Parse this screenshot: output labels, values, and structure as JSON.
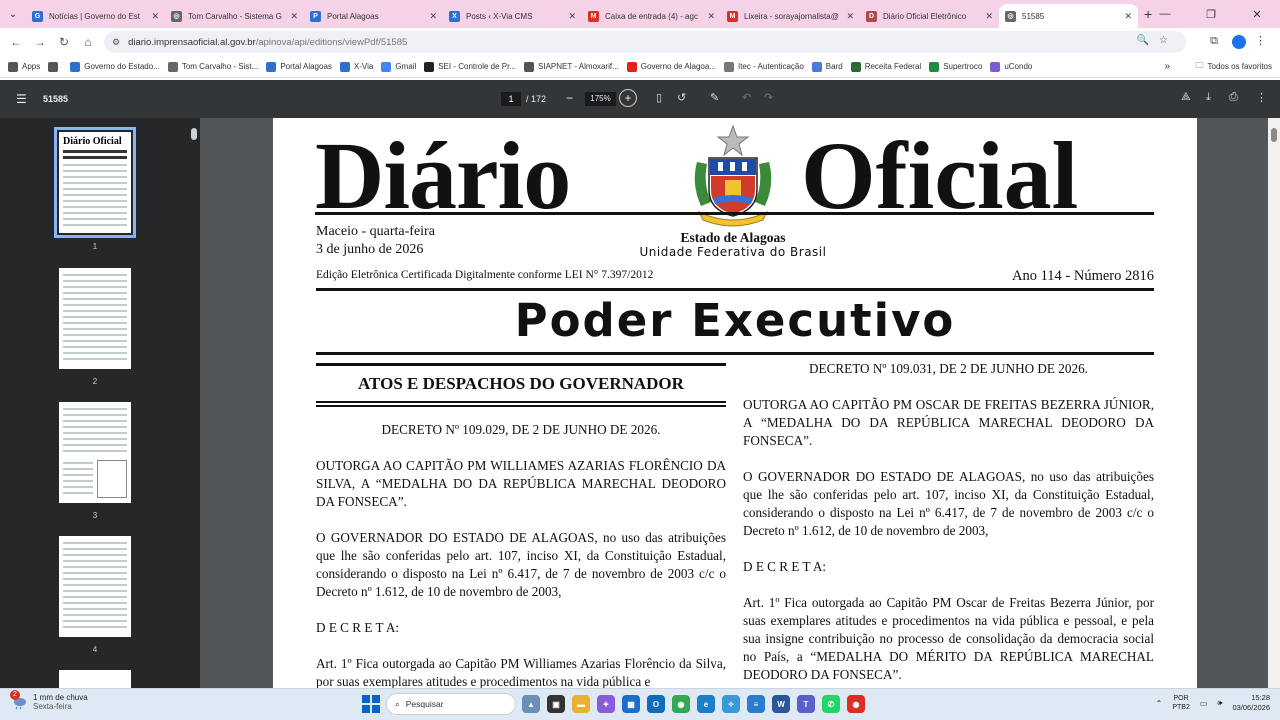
{
  "tabs": [
    {
      "title": "Notícias | Governo do Est",
      "icon": "gov-icon",
      "color": "#2e6fd0",
      "letter": "G"
    },
    {
      "title": "Tom Carvalho - Sistema G",
      "icon": "globe-icon",
      "color": "#666666",
      "letter": "◎"
    },
    {
      "title": "Portal Alagoas",
      "icon": "portal-icon",
      "color": "#2e6fd0",
      "letter": "P"
    },
    {
      "title": "Posts ‹ X-Via CMS",
      "icon": "cms-icon",
      "color": "#2e6fd0",
      "letter": "X"
    },
    {
      "title": "Caixa de entrada (4) - agc",
      "icon": "gmail-icon",
      "color": "#d93025",
      "letter": "M"
    },
    {
      "title": "Lixeira - sorayajornalista@",
      "icon": "gmail-icon",
      "color": "#d93025",
      "letter": "M"
    },
    {
      "title": "Diário Oficial Eletrônico",
      "icon": "diario-icon",
      "color": "#b04848",
      "letter": "D"
    },
    {
      "title": "51585",
      "icon": "globe-icon",
      "color": "#666666",
      "letter": "◎"
    }
  ],
  "address": {
    "host": "diario.imprensaoficial.al.gov.br",
    "path": "/apinova/api/editions/viewPdf/51585"
  },
  "bookmarks": [
    {
      "label": "Apps",
      "color": "#555555"
    },
    {
      "label": "",
      "color": "#555555"
    },
    {
      "label": "Governo do Estado...",
      "color": "#2e6fd0"
    },
    {
      "label": "Tom Carvalho - Sist...",
      "color": "#666666"
    },
    {
      "label": "Portal Alagoas",
      "color": "#2e6fd0"
    },
    {
      "label": "X-Via",
      "color": "#2e6fd0"
    },
    {
      "label": "Gmail",
      "color": "#4285f4"
    },
    {
      "label": "SEI - Controle de Pr...",
      "color": "#222222"
    },
    {
      "label": "SIAPNET - Almoxarif...",
      "color": "#555555"
    },
    {
      "label": "Governo de Alagoa...",
      "color": "#e62117"
    },
    {
      "label": "Itec - Autenticação",
      "color": "#777777"
    },
    {
      "label": "Bard",
      "color": "#4a7bd8"
    },
    {
      "label": "Receita Federal",
      "color": "#2a6b3a"
    },
    {
      "label": "Supertroco",
      "color": "#1e8e3e"
    },
    {
      "label": "uCondo",
      "color": "#7b5cd6"
    }
  ],
  "bookmarks_all": "Todos os favoritos",
  "pdf": {
    "doc_title": "51585",
    "page": "1",
    "page_total": "/ 172",
    "zoom": "175%"
  },
  "thumbs": [
    "1",
    "2",
    "3",
    "4"
  ],
  "doc": {
    "mast_left": "Diário",
    "mast_right": "Oficial",
    "city": "Maceio - quarta-feira",
    "date": "3 de junho de 2026",
    "estado": "Estado de Alagoas",
    "uniao": "Unidade Federativa do Brasil",
    "edicao": "Edição Eletrônica Certificada Digitalmente conforme LEI N° 7.397/2012",
    "ano": "Ano 114 - Número 2816",
    "poder": "Poder Executivo",
    "atos": "ATOS E DESPACHOS DO GOVERNADOR",
    "left": {
      "decreto": "DECRETO Nº 109.029, DE 2 DE JUNHO DE 2026.",
      "outorga": "OUTORGA AO CAPITÃO PM WILLIAMES AZARIAS FLORÊNCIO DA SILVA, A “MEDALHA DO    DA REPÚBLICA MARECHAL DEODORO DA FONSECA”.",
      "governador": "O GOVERNADOR DO ESTADO DE ALAGOAS, no uso das atribuições que lhe são conferidas pelo art. 107, inciso XI, da Constituição Estadual, considerando o disposto na Lei nº 6.417, de 7 de novembro de 2003 c/c o Decreto nº 1.612, de 10 de novembro de 2003,",
      "decreta": "D E C R E T A:",
      "art1": "Art. 1º Fica outorgada ao Capitão PM Williames Azarias Florêncio da Silva, por suas exemplares atitudes e procedimentos na vida pública e"
    },
    "right": {
      "decreto": "DECRETO Nº 109.031, DE 2 DE JUNHO DE 2026.",
      "outorga": "OUTORGA AO CAPITÃO PM OSCAR DE FREITAS BEZERRA JÚNIOR, A “MEDALHA DO    DA REPÚBLICA MARECHAL DEODORO DA FONSECA”.",
      "governador": "O GOVERNADOR DO ESTADO DE ALAGOAS, no uso das atribuições que lhe são conferidas pelo art. 107, inciso XI, da Constituição Estadual, considerando o disposto na Lei nº 6.417, de 7 de novembro de 2003 c/c o Decreto nº 1.612, de 10 de novembro de 2003,",
      "decreta": "D E C R E T A:",
      "art1": "Art. 1º Fica outorgada ao Capitão PM Oscar de Freitas Bezerra Júnior, por suas exemplares atitudes e procedimentos na vida pública e pessoal, e pela sua insigne contribuição no processo de consolidação da democracia social no País, a “MEDALHA DO MÉRITO DA REPÚBLICA MARECHAL DEODORO DA FONSECA”."
    }
  },
  "taskbar": {
    "badge": "2",
    "weather": "1 mm de chuva",
    "weekday": "Sexta-feira",
    "search": "Pesquisar",
    "lang1": "POR",
    "lang2": "PTB2",
    "time": "15:28",
    "date": "03/06/2026",
    "apps": [
      {
        "name": "landscape-icon",
        "color": "#6b8fb5",
        "g": "▲"
      },
      {
        "name": "task-view-icon",
        "color": "#333333",
        "g": "▣"
      },
      {
        "name": "file-explorer-icon",
        "color": "#e8b230",
        "g": "▬"
      },
      {
        "name": "copilot-icon",
        "color": "#8a5cd8",
        "g": "✦"
      },
      {
        "name": "store-icon",
        "color": "#1c6ec9",
        "g": "▦"
      },
      {
        "name": "outlook-icon",
        "color": "#0f6cbd",
        "g": "O"
      },
      {
        "name": "chrome-icon",
        "color": "#34a853",
        "g": "◉"
      },
      {
        "name": "edge-icon",
        "color": "#1a7fc8",
        "g": "e"
      },
      {
        "name": "copilot-app-icon",
        "color": "#3a9ad9",
        "g": "✧"
      },
      {
        "name": "notepad-icon",
        "color": "#2b7bd0",
        "g": "≡"
      },
      {
        "name": "word-icon",
        "color": "#2b579a",
        "g": "W"
      },
      {
        "name": "teams-icon",
        "color": "#5b5fc7",
        "g": "T"
      },
      {
        "name": "whatsapp-icon",
        "color": "#25d366",
        "g": "✆"
      },
      {
        "name": "chrome-profile-icon",
        "color": "#d93025",
        "g": "◉"
      }
    ]
  }
}
